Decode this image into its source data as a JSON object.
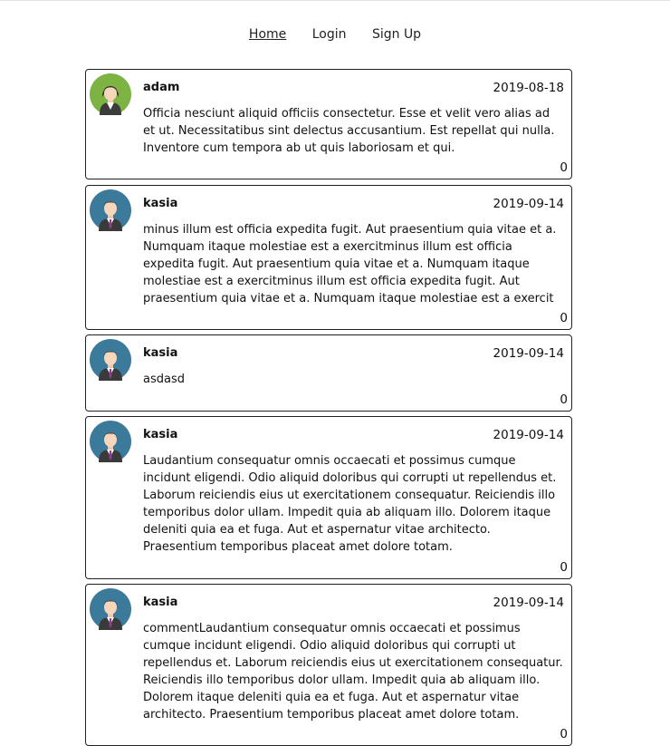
{
  "nav": {
    "home": "Home",
    "login": "Login",
    "signup": "Sign Up"
  },
  "colors": {
    "avatar_female_bg": "#7cb342",
    "avatar_male_bg": "#3b7a9b"
  },
  "posts": [
    {
      "author": "adam",
      "date": "2019-08-18",
      "avatar": "female-avatar-icon",
      "content": "Officia nesciunt aliquid officiis consectetur. Esse et velit vero alias ad et ut. Necessitatibus sint delectus accusantium. Est repellat qui nulla. Inventore cum tempora ab ut quis laboriosam et qui.",
      "count": "0"
    },
    {
      "author": "kasia",
      "date": "2019-09-14",
      "avatar": "male-avatar-icon",
      "content": "minus illum est officia expedita fugit. Aut praesentium quia vitae et a. Numquam itaque molestiae est a exercitminus illum est officia expedita fugit. Aut praesentium quia vitae et a. Numquam itaque molestiae est a exercitminus illum est officia expedita fugit. Aut praesentium quia vitae et a. Numquam itaque molestiae est a exercit",
      "count": "0"
    },
    {
      "author": "kasia",
      "date": "2019-09-14",
      "avatar": "male-avatar-icon",
      "content": "asdasd",
      "count": "0"
    },
    {
      "author": "kasia",
      "date": "2019-09-14",
      "avatar": "male-avatar-icon",
      "content": "Laudantium consequatur omnis occaecati et possimus cumque incidunt eligendi. Odio aliquid doloribus qui corrupti ut repellendus et. Laborum reiciendis eius ut exercitationem consequatur. Reiciendis illo temporibus dolor ullam. Impedit quia ab aliquam illo. Dolorem itaque deleniti quia ea et fuga. Aut et aspernatur vitae architecto. Praesentium temporibus placeat amet dolore totam.",
      "count": "0"
    },
    {
      "author": "kasia",
      "date": "2019-09-14",
      "avatar": "male-avatar-icon",
      "content": "commentLaudantium consequatur omnis occaecati et possimus cumque incidunt eligendi. Odio aliquid doloribus qui corrupti ut repellendus et. Laborum reiciendis eius ut exercitationem consequatur. Reiciendis illo temporibus dolor ullam. Impedit quia ab aliquam illo. Dolorem itaque deleniti quia ea et fuga. Aut et aspernatur vitae architecto. Praesentium temporibus placeat amet dolore totam.",
      "count": "0"
    }
  ]
}
